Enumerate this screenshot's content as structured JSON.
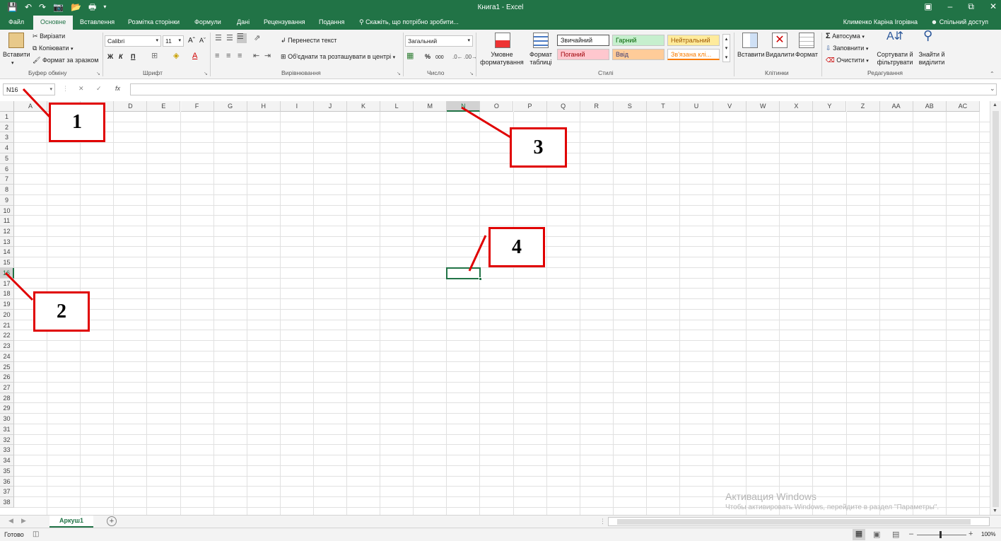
{
  "app": {
    "title": "Книга1 - Excel",
    "accent": "#217346"
  },
  "qat": {
    "save_icon": "save-icon",
    "undo_icon": "undo-icon",
    "redo_icon": "redo-icon",
    "camera_icon": "camera-icon",
    "open_icon": "open-icon",
    "print_icon": "print-icon"
  },
  "tabs": [
    {
      "label": "Файл"
    },
    {
      "label": "Основне"
    },
    {
      "label": "Вставлення"
    },
    {
      "label": "Розмітка сторінки"
    },
    {
      "label": "Формули"
    },
    {
      "label": "Дані"
    },
    {
      "label": "Рецензування"
    },
    {
      "label": "Подання"
    }
  ],
  "tell_me": "Скажіть, що потрібно зробити...",
  "user": "Клименко Каріна Ігорівна",
  "share": "Спільний доступ",
  "ribbon": {
    "clipboard": {
      "paste": "Вставити",
      "cut": "Вирізати",
      "copy": "Копіювати",
      "format_painter": "Формат за зразком",
      "label": "Буфер обміну"
    },
    "font": {
      "name": "Calibri",
      "size": "11",
      "bold": "Ж",
      "italic": "К",
      "underline": "П",
      "label": "Шрифт"
    },
    "alignment": {
      "wrap": "Перенести текст",
      "merge": "Об'єднати та розташувати в центрі",
      "label": "Вирівнювання"
    },
    "number": {
      "format": "Загальний",
      "percent": "%",
      "thousands": "000",
      "label": "Число"
    },
    "styles": {
      "conditional": "Умовне форматування",
      "table": "Формат таблиці",
      "normal": "Звичайний",
      "good": "Гарний",
      "neutral": "Нейтральний",
      "bad": "Поганий",
      "input": "Ввід",
      "linked": "Зв'язана клі...",
      "label": "Стилі"
    },
    "cells": {
      "insert": "Вставити",
      "delete": "Видалити",
      "format": "Формат",
      "label": "Клітинки"
    },
    "editing": {
      "autosum": "Автосума",
      "fill": "Заповнити",
      "clear": "Очистити",
      "sort": "Сортувати й фільтрувати",
      "find": "Знайти й виділити",
      "label": "Редагування"
    }
  },
  "formula_bar": {
    "name_box": "N16",
    "fx": "fx",
    "formula": ""
  },
  "columns": [
    "A",
    "B",
    "C",
    "D",
    "E",
    "F",
    "G",
    "H",
    "I",
    "J",
    "K",
    "L",
    "M",
    "N",
    "O",
    "P",
    "Q",
    "R",
    "S",
    "T",
    "U",
    "V",
    "W",
    "X",
    "Y",
    "Z",
    "AA",
    "AB",
    "AC"
  ],
  "rows_count": 38,
  "active_cell": {
    "col": "N",
    "row": 16
  },
  "sheet": {
    "tab": "Аркуш1",
    "add": "+"
  },
  "status": {
    "ready": "Готово",
    "zoom": "100%"
  },
  "watermark": {
    "line1": "Активация Windows",
    "line2": "Чтобы активировать Windows, перейдите в раздел \"Параметры\"."
  },
  "callouts": [
    "1",
    "2",
    "3",
    "4"
  ]
}
